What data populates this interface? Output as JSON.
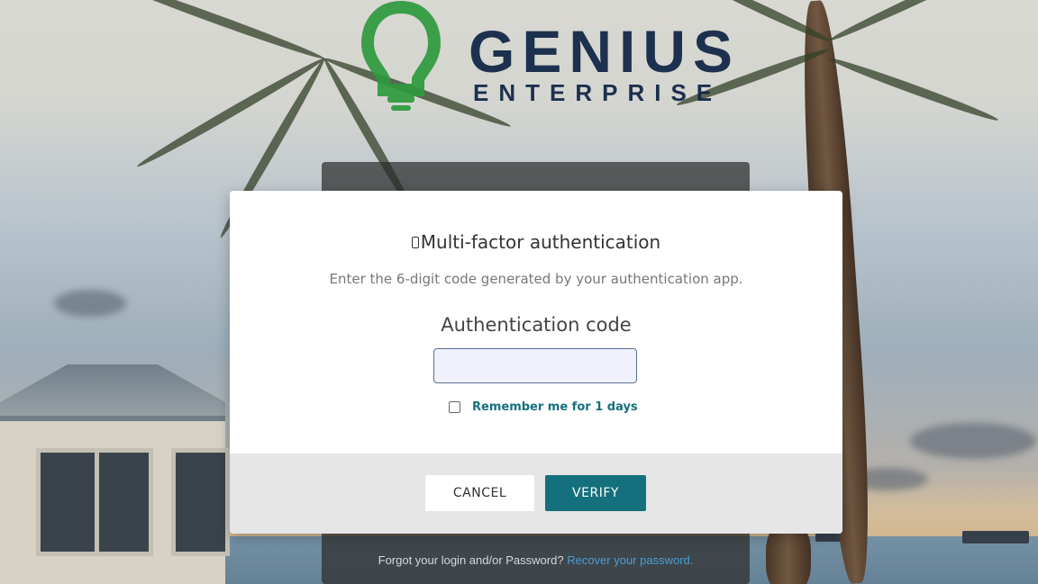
{
  "brand": {
    "name": "GENIUS",
    "tagline": "ENTERPRISE",
    "colors": {
      "navy": "#0e2345",
      "green": "#2e9a3e"
    }
  },
  "login_panel": {
    "forgot_text": "Forgot your login and/or Password?",
    "recover_link": "Recover your password."
  },
  "mfa_dialog": {
    "icon": "phone-icon",
    "title": "Multi-factor authentication",
    "instructions": "Enter the 6-digit code generated by your authentication app.",
    "code_label": "Authentication code",
    "code_value": "",
    "remember_label": "Remember me for 1 days",
    "remember_checked": false,
    "cancel_label": "CANCEL",
    "verify_label": "VERIFY",
    "accent_color": "#14707d"
  }
}
